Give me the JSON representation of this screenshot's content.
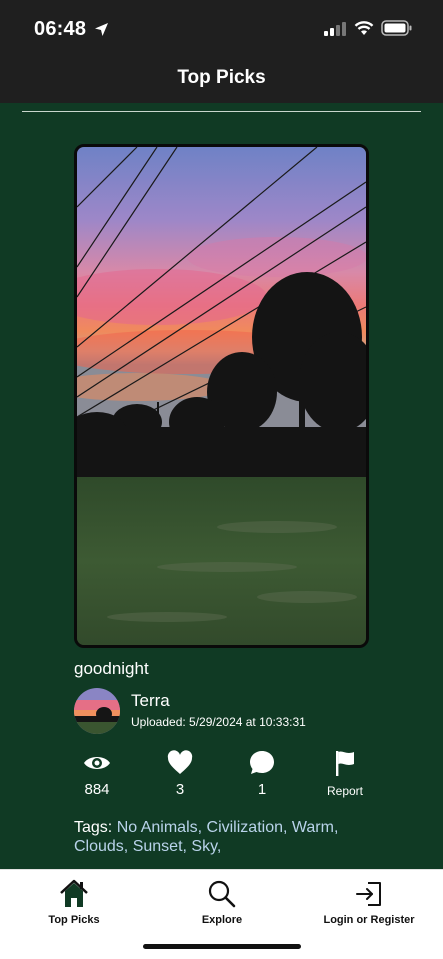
{
  "status_bar": {
    "time": "06:48",
    "icons": [
      "location-arrow-icon",
      "cellular-signal-icon",
      "wifi-icon",
      "battery-icon"
    ]
  },
  "header": {
    "title": "Top Picks"
  },
  "post": {
    "title": "goodnight",
    "author": "Terra",
    "uploaded": "Uploaded: 5/29/2024 at 10:33:31",
    "stats": {
      "views": "884",
      "likes": "3",
      "comments": "1",
      "report_label": "Report"
    },
    "tags_label": "Tags:",
    "tags_text": "No Animals, Civilization, Warm, Clouds, Sunset, Sky,"
  },
  "tabbar": {
    "items": [
      {
        "label": "Top Picks",
        "icon": "home-icon"
      },
      {
        "label": "Explore",
        "icon": "search-icon"
      },
      {
        "label": "Login or Register",
        "icon": "login-icon"
      }
    ]
  },
  "colors": {
    "background": "#103a24",
    "bars": "#1f1f1f",
    "tag_text": "#b9d3ea",
    "tabbar": "#ffffff"
  }
}
